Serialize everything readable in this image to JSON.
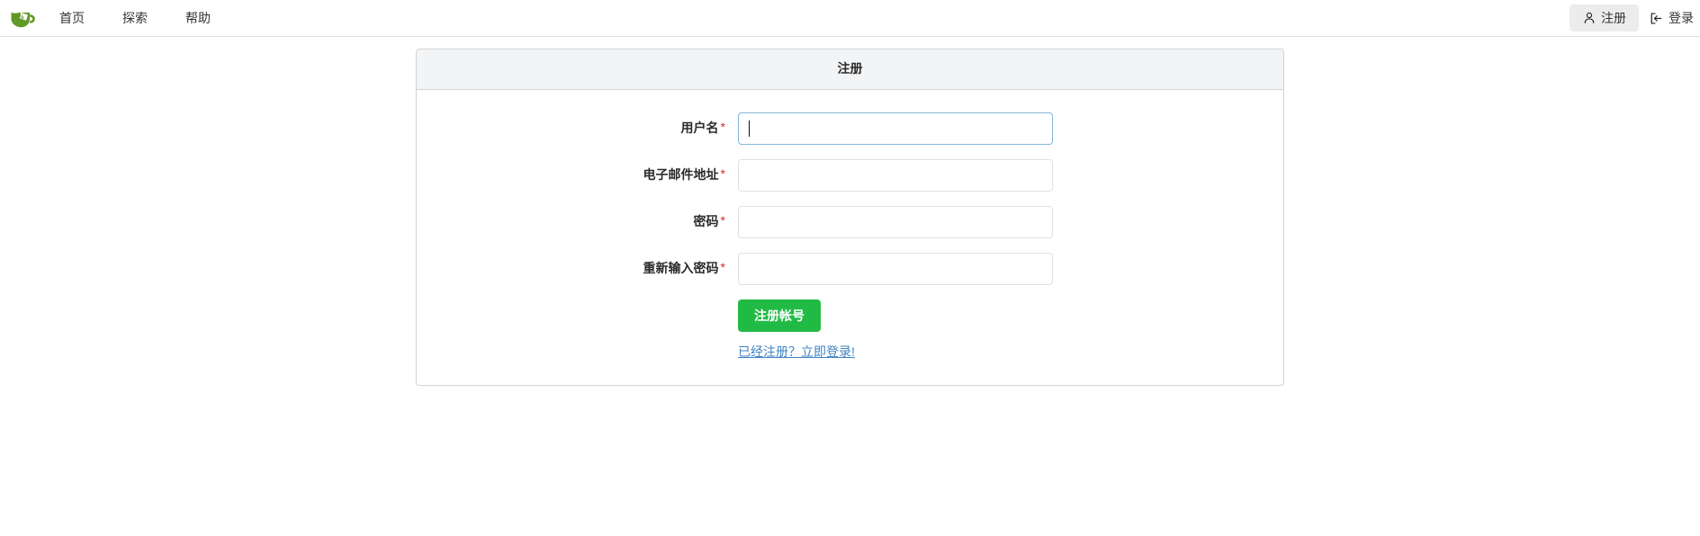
{
  "navbar": {
    "brand": {
      "icon": "gitea-teacup-logo",
      "colors": {
        "cup": "#609926",
        "leaf": "#ffffff"
      }
    },
    "left_items": [
      {
        "label": "首页",
        "icon": "home-link"
      },
      {
        "label": "探索",
        "icon": "explore-link"
      },
      {
        "label": "帮助",
        "icon": "help-link"
      }
    ],
    "right_items": [
      {
        "label": "注册",
        "icon": "user-plus-icon",
        "active": true
      },
      {
        "label": "登录",
        "icon": "sign-in-icon",
        "active": false
      }
    ]
  },
  "card": {
    "title": "注册",
    "fields": [
      {
        "label": "用户名",
        "required_mark": "*",
        "value": "",
        "placeholder": "",
        "type": "text",
        "focused": true,
        "name": "username"
      },
      {
        "label": "电子邮件地址",
        "required_mark": "*",
        "value": "",
        "placeholder": "",
        "type": "email",
        "focused": false,
        "name": "email"
      },
      {
        "label": "密码",
        "required_mark": "*",
        "value": "",
        "placeholder": "",
        "type": "password",
        "focused": false,
        "name": "password"
      },
      {
        "label": "重新输入密码",
        "required_mark": "*",
        "value": "",
        "placeholder": "",
        "type": "password",
        "focused": false,
        "name": "retype-password"
      }
    ],
    "submit_label": "注册帐号",
    "signin_prompt": "已经注册？立即登录!"
  },
  "colors": {
    "brand_green": "#609926",
    "button_green": "#21ba45",
    "link_blue": "#4183c4",
    "required_red": "#db2828",
    "header_bg": "#f3f4f5",
    "border_gray": "#d4d4d5",
    "focus_blue": "#85b7d9",
    "active_pill_bg": "#ececec"
  }
}
